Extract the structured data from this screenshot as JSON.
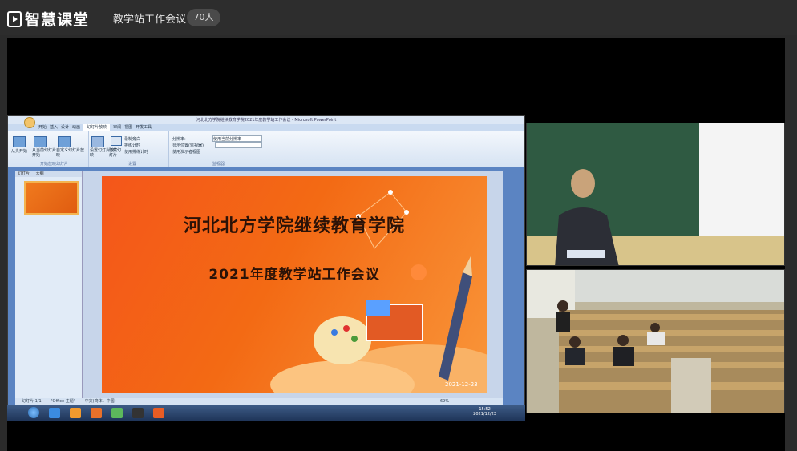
{
  "app": {
    "brand": "智慧课堂"
  },
  "meeting": {
    "title": "教学站工作会议",
    "participants": "70人"
  },
  "shared_screen": {
    "window_title": "河北北方学院继续教育学院2021年度教学站工作会议 - Microsoft PowerPoint",
    "ribbon_tabs": [
      "开始",
      "插入",
      "设计",
      "动画",
      "幻灯片放映",
      "审阅",
      "视图",
      "开发工具"
    ],
    "active_tab": "幻灯片放映",
    "ribbon_buttons": [
      "从头开始",
      "从当前幻灯片开始",
      "自定义幻灯片放映",
      "设置幻灯片放映",
      "隐藏幻灯片",
      "录制旁白",
      "排练计时",
      "使用排练计时",
      "分辨率:",
      "使用当前分辨率",
      "显示位置(监视器):",
      "使用演示者视图"
    ],
    "ribbon_groups": [
      "开始放映幻灯片",
      "设置",
      "监视器"
    ],
    "pane_tabs": [
      "幻灯片",
      "大纲"
    ],
    "slide": {
      "title": "河北北方学院继续教育学院",
      "subtitle": "2021年度教学站工作会议",
      "date": "2021-12-23"
    },
    "statusbar": {
      "slide_info": "幻灯片 1/1",
      "theme": "\"Office 主题\"",
      "language": "中文(简体，中国)",
      "zoom": "69%"
    },
    "clock": {
      "time": "15:52",
      "date": "2021/12/23"
    }
  },
  "cameras": [
    {
      "name": "teacher-camera"
    },
    {
      "name": "classroom-camera"
    }
  ]
}
